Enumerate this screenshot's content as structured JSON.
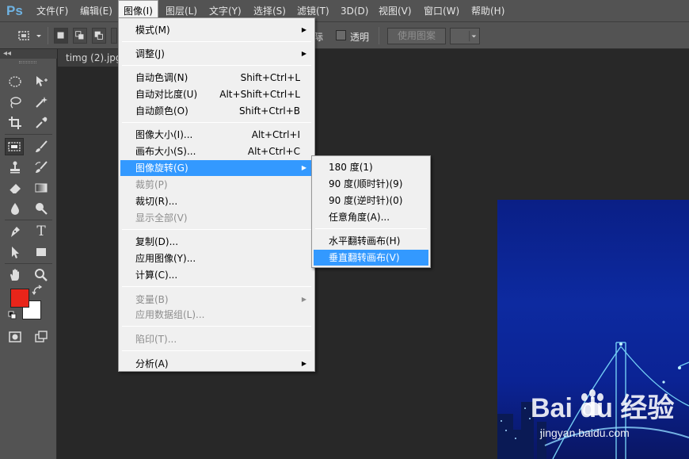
{
  "app": {
    "logo": "Ps"
  },
  "menubar": {
    "items": [
      {
        "label": "文件(F)"
      },
      {
        "label": "编辑(E)"
      },
      {
        "label": "图像(I)"
      },
      {
        "label": "图层(L)"
      },
      {
        "label": "文字(Y)"
      },
      {
        "label": "选择(S)"
      },
      {
        "label": "滤镜(T)"
      },
      {
        "label": "3D(D)"
      },
      {
        "label": "视图(V)"
      },
      {
        "label": "窗口(W)"
      },
      {
        "label": "帮助(H)"
      }
    ],
    "active_item": "图像(I)"
  },
  "options_bar": {
    "partial_label": "际",
    "transparent_label": "透明",
    "use_pattern_label": "使用图案"
  },
  "toolbar": {
    "collapse_glyph": "◂◂",
    "tools": [
      "ellipse-marquee-icon",
      "move-icon",
      "lasso-icon",
      "magic-wand-icon",
      "crop-icon",
      "eyedropper-icon",
      "patch-icon",
      "brush-icon",
      "stamp-icon",
      "history-brush-icon",
      "eraser-icon",
      "gradient-icon",
      "blur-icon",
      "dodge-icon",
      "pen-icon",
      "type-icon",
      "path-select-icon",
      "rectangle-icon",
      "hand-icon",
      "zoom-icon"
    ],
    "selected_tool": "patch-icon",
    "type_tool_glyph": "T",
    "foreground_color": "#e8251a",
    "background_color": "#ffffff"
  },
  "document": {
    "tab_label": "timg (2).jpg"
  },
  "image_menu": {
    "items": [
      {
        "label": "模式(M)",
        "shortcut": "",
        "submenu": true,
        "disabled": false
      },
      {
        "label": "调整(J)",
        "shortcut": "",
        "submenu": true,
        "disabled": false
      },
      {
        "label": "自动色调(N)",
        "shortcut": "Shift+Ctrl+L",
        "submenu": false,
        "disabled": false
      },
      {
        "label": "自动对比度(U)",
        "shortcut": "Alt+Shift+Ctrl+L",
        "submenu": false,
        "disabled": false
      },
      {
        "label": "自动颜色(O)",
        "shortcut": "Shift+Ctrl+B",
        "submenu": false,
        "disabled": false
      },
      {
        "label": "图像大小(I)...",
        "shortcut": "Alt+Ctrl+I",
        "submenu": false,
        "disabled": false
      },
      {
        "label": "画布大小(S)...",
        "shortcut": "Alt+Ctrl+C",
        "submenu": false,
        "disabled": false
      },
      {
        "label": "图像旋转(G)",
        "shortcut": "",
        "submenu": true,
        "disabled": false,
        "highlighted": true
      },
      {
        "label": "裁剪(P)",
        "shortcut": "",
        "submenu": false,
        "disabled": true
      },
      {
        "label": "裁切(R)...",
        "shortcut": "",
        "submenu": false,
        "disabled": false
      },
      {
        "label": "显示全部(V)",
        "shortcut": "",
        "submenu": false,
        "disabled": true
      },
      {
        "label": "复制(D)...",
        "shortcut": "",
        "submenu": false,
        "disabled": false
      },
      {
        "label": "应用图像(Y)...",
        "shortcut": "",
        "submenu": false,
        "disabled": false
      },
      {
        "label": "计算(C)...",
        "shortcut": "",
        "submenu": false,
        "disabled": false
      },
      {
        "label": "变量(B)",
        "shortcut": "",
        "submenu": true,
        "disabled": true
      },
      {
        "label": "应用数据组(L)...",
        "shortcut": "",
        "submenu": false,
        "disabled": true
      },
      {
        "label": "陷印(T)...",
        "shortcut": "",
        "submenu": false,
        "disabled": true
      },
      {
        "label": "分析(A)",
        "shortcut": "",
        "submenu": true,
        "disabled": false
      }
    ]
  },
  "rotate_submenu": {
    "items": [
      {
        "label": "180 度(1)"
      },
      {
        "label": "90 度(顺时针)(9)"
      },
      {
        "label": "90 度(逆时针)(0)"
      },
      {
        "label": "任意角度(A)..."
      },
      {
        "label": "水平翻转画布(H)"
      },
      {
        "label": "垂直翻转画布(V)",
        "highlighted": true
      }
    ]
  },
  "watermark": {
    "logo_text": "Bai du 经验",
    "url": "jingyan.baidu.com"
  },
  "submenu_arrow": "▶"
}
